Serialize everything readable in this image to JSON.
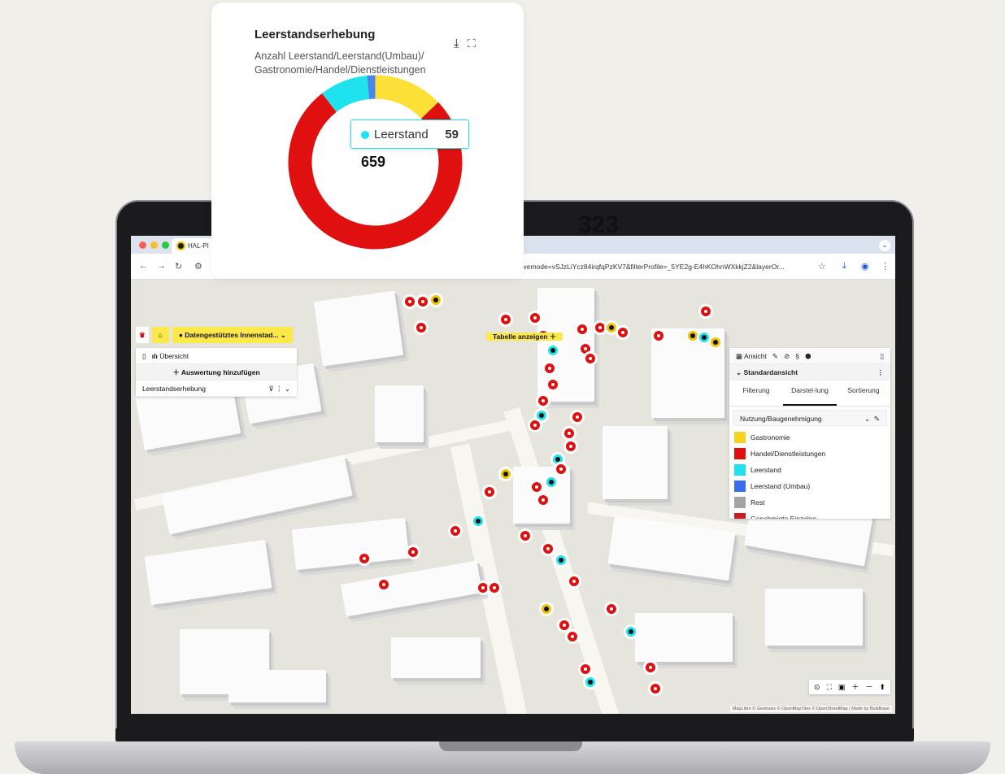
{
  "browser": {
    "tab_title": "HAL-PI",
    "url": "ctivemode=vSJzLiYcz84irqfqPzKV7&filterProfile=_5YE2g-E4hKOhnWXkkjZ2&layerOr..."
  },
  "app": {
    "breadcrumb_label": "Datengestütztes Innenstad...",
    "table_button": "Tabelle anzeigen",
    "left_panel": {
      "tab_overview": "Übersicht",
      "add_analysis": "Auswertung hinzufügen",
      "analysis_item": "Leerstandserhebung"
    },
    "right_panel": {
      "tab_view": "Ansicht",
      "view_name": "Standardansicht",
      "tabs": [
        "Filterung",
        "Darstel-lung",
        "Sortierung"
      ],
      "select_value": "Nutzung/Baugenehmigung",
      "legend": [
        {
          "label": "Gastronomie",
          "color": "#f7d21e"
        },
        {
          "label": "Handel/Dienstleistungen",
          "color": "#e01010"
        },
        {
          "label": "Leerstand",
          "color": "#1ee3ee"
        },
        {
          "label": "Leerstand (Umbau)",
          "color": "#3a6cf0"
        },
        {
          "label": "Rest",
          "color": "#a3a3a3"
        },
        {
          "label": "Genehmigte Einzelne",
          "color": "#c81e1e"
        }
      ]
    },
    "attribution": "MapLibre © Geobasis © OpenMapTiles © OpenStreetMap | Made by Buildbase"
  },
  "card": {
    "title": "Leerstandserhebung",
    "subtitle": "Anzahl Leerstand/Leerstand(Umbau)/ Gastronomie/Handel/Dienstleistungen",
    "total": "659",
    "tooltip_label": "Leerstand",
    "tooltip_value": "59"
  },
  "under_number": "323",
  "chart_data": {
    "type": "pie",
    "categories": [
      "Gastronomie",
      "Handel/Dienstleistungen",
      "Leerstand",
      "Leerstand (Umbau)"
    ],
    "values": [
      85,
      505,
      59,
      10
    ],
    "colors": [
      "#fde037",
      "#e01010",
      "#1ee3ee",
      "#4a86e8"
    ]
  }
}
